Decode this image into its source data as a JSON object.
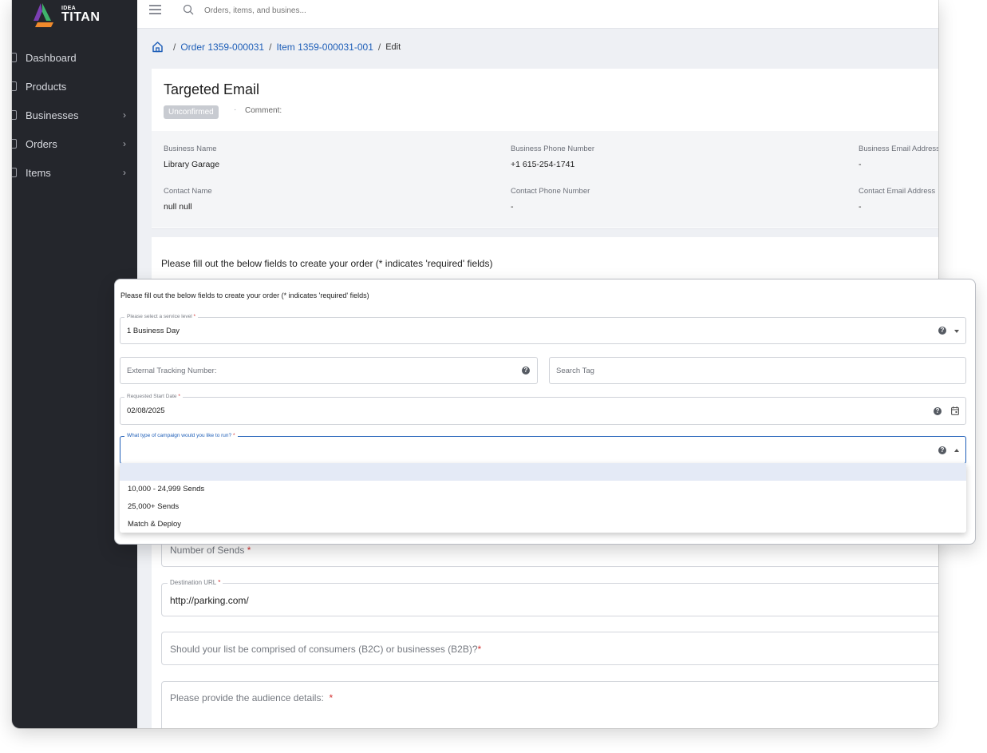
{
  "app": {
    "brand_small": "IDEA",
    "brand_big": "TITAN"
  },
  "sidebar": {
    "items": [
      {
        "label": "Dashboard",
        "chevron": false
      },
      {
        "label": "Products",
        "chevron": false
      },
      {
        "label": "Businesses",
        "chevron": true
      },
      {
        "label": "Orders",
        "chevron": true
      },
      {
        "label": "Items",
        "chevron": true
      }
    ]
  },
  "topbar": {
    "search_placeholder": "Orders, items, and busines..."
  },
  "breadcrumb": {
    "order": "Order 1359-000031",
    "item": "Item 1359-000031-001",
    "current": "Edit",
    "separator": "/"
  },
  "header": {
    "title": "Targeted Email",
    "status_badge": "Unconfirmed",
    "dot": "·",
    "comment_label": "Comment:"
  },
  "info": {
    "business_name_label": "Business Name",
    "business_name": "Library Garage",
    "business_phone_label": "Business Phone Number",
    "business_phone": "+1 615-254-1741",
    "business_email_label": "Business Email Address",
    "business_email": "-",
    "contact_name_label": "Contact Name",
    "contact_name": "null null",
    "contact_phone_label": "Contact Phone Number",
    "contact_phone": "-",
    "contact_email_label": "Contact Email Address",
    "contact_email": "-"
  },
  "form": {
    "intro": "Please fill out the below fields to create your order (* indicates 'required' fields)",
    "number_of_sends": "Number of Sends",
    "destination_url_label": "Destination URL",
    "destination_url": "http://parking.com/",
    "b2c_b2b_question": "Should your list be comprised of consumers (B2C) or businesses (B2B)?",
    "audience_details": "Please provide the audience details:",
    "required_mark": "*"
  },
  "overlay": {
    "intro": "Please fill out the below fields to create your order (* indicates 'required' fields)",
    "service_level_label": "Please select a service level",
    "service_level_value": "1 Business Day",
    "external_tracking_placeholder": "External Tracking Number:",
    "search_tag_placeholder": "Search Tag",
    "start_date_label": "Requested Start Date",
    "start_date_value": "02/08/2025",
    "campaign_label": "What type of campaign would you like to run?",
    "campaign_options": [
      "10,000 - 24,999 Sends",
      "25,000+ Sends",
      "Match & Deploy"
    ],
    "help_glyph": "?"
  },
  "colors": {
    "sidebar_bg": "#24262c",
    "link": "#1f5fb8",
    "required": "#d32f2f",
    "badge_bg": "#c8cbd1",
    "highlight": "#e4eaf6"
  }
}
